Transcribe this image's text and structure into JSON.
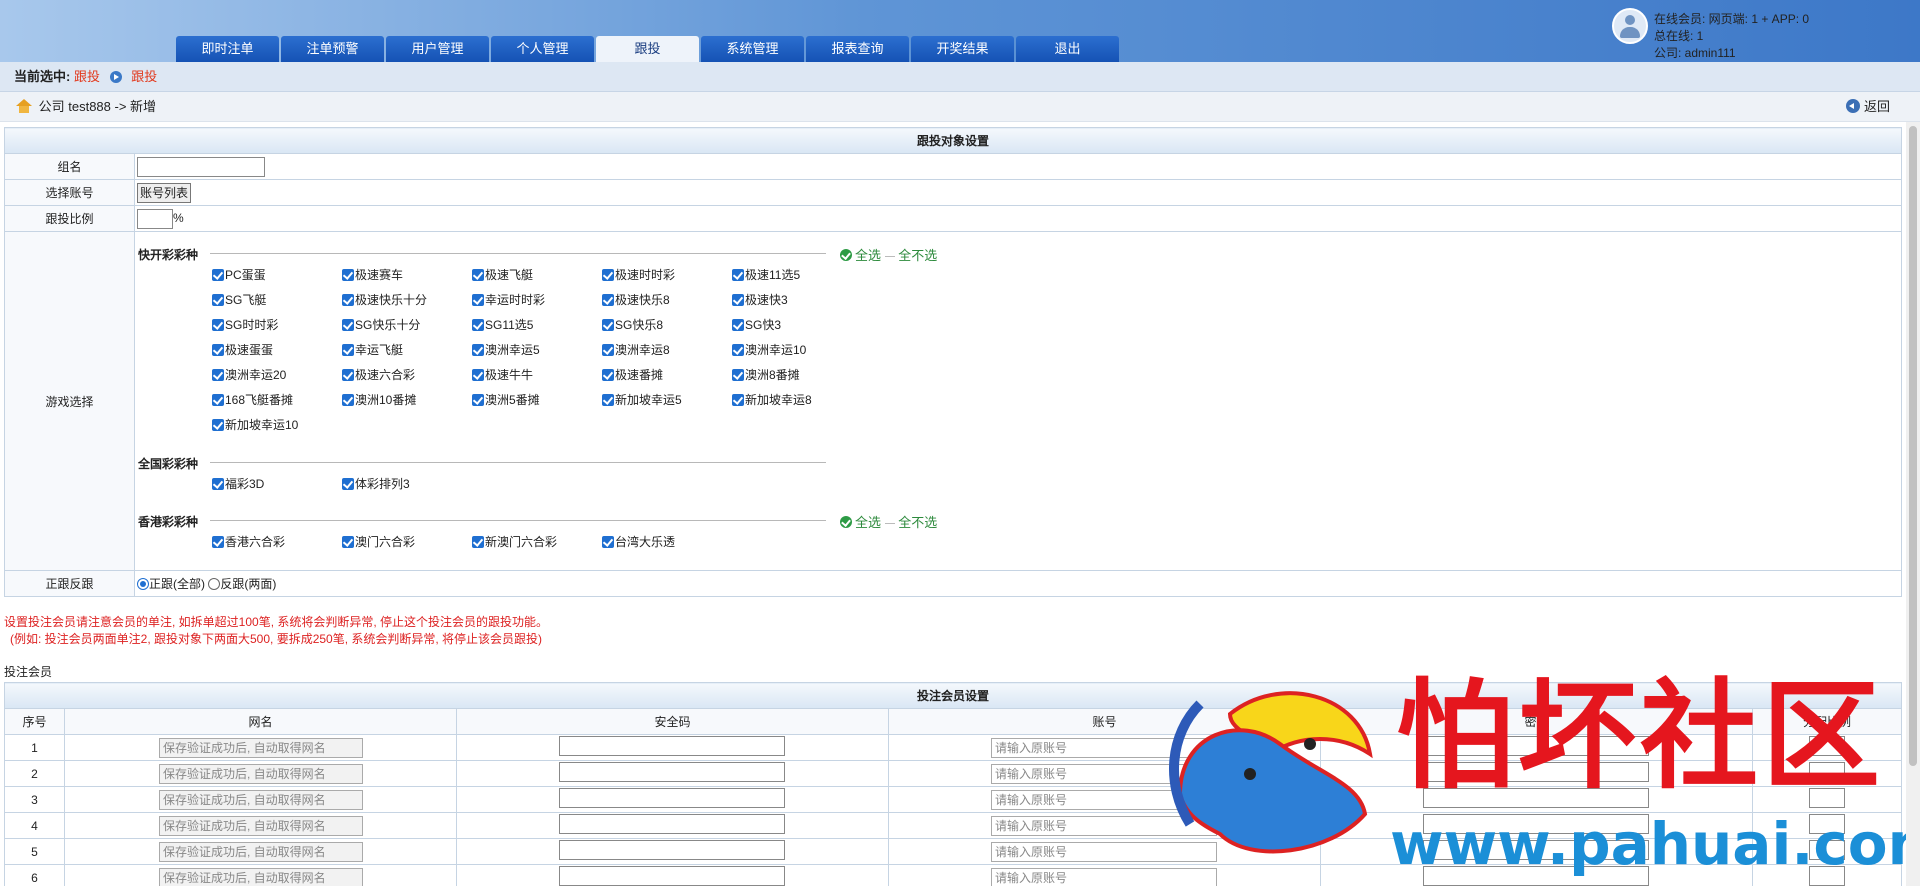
{
  "nav": {
    "tabs": [
      "即时注单",
      "注单预警",
      "用户管理",
      "个人管理",
      "跟投",
      "系统管理",
      "报表查询",
      "开奖结果",
      "退出"
    ],
    "active": "跟投"
  },
  "user": {
    "line1": "在线会员:   网页端: 1 + APP: 0",
    "line2": "总在线:  1",
    "line3": "公司: admin111"
  },
  "crumb": {
    "label": "当前选中:",
    "item1": "跟投",
    "item2": "跟投"
  },
  "path": {
    "text": "公司 test888 -> 新增",
    "back": "返回"
  },
  "settings": {
    "title": "跟投对象设置",
    "group_name_label": "组名",
    "account_label": "选择账号",
    "account_button": "账号列表",
    "ratio_label": "跟投比例",
    "ratio_unit": "%",
    "game_label": "游戏选择",
    "direction_label": "正跟反跟",
    "direction_options": [
      "正跟(全部)",
      "反跟(两面)"
    ],
    "select_all": "全选",
    "deselect_all": "全不选",
    "groups": {
      "fast": {
        "title": "快开彩彩种",
        "items": [
          "PC蛋蛋",
          "极速赛车",
          "极速飞艇",
          "极速时时彩",
          "极速11选5",
          "SG飞艇",
          "极速快乐十分",
          "幸运时时彩",
          "极速快乐8",
          "极速快3",
          "SG时时彩",
          "SG快乐十分",
          "SG11选5",
          "SG快乐8",
          "SG快3",
          "极速蛋蛋",
          "幸运飞艇",
          "澳洲幸运5",
          "澳洲幸运8",
          "澳洲幸运10",
          "澳洲幸运20",
          "极速六合彩",
          "极速牛牛",
          "极速番摊",
          "澳洲8番摊",
          "168飞艇番摊",
          "澳洲10番摊",
          "澳洲5番摊",
          "新加坡幸运5",
          "新加坡幸运8",
          "新加坡幸运10"
        ]
      },
      "national": {
        "title": "全国彩彩种",
        "items": [
          "福彩3D",
          "体彩排列3"
        ]
      },
      "hk": {
        "title": "香港彩彩种",
        "items": [
          "香港六合彩",
          "澳门六合彩",
          "新澳门六合彩",
          "台湾大乐透"
        ]
      }
    }
  },
  "notice": {
    "line1": "设置投注会员请注意会员的单注, 如拆单超过100笔, 系统将会判断异常, 停止这个投注会员的跟投功能。",
    "line2": "(例如: 投注会员两面单注2, 跟投对象下两面大500, 要拆成250笔, 系统会判断异常, 将停止该会员跟投)"
  },
  "members": {
    "section_label": "投注会员",
    "title": "投注会员设置",
    "columns": [
      "序号",
      "网名",
      "安全码",
      "账号",
      "密码",
      "分配比例"
    ],
    "netname_placeholder": "保存验证成功后, 自动取得网名",
    "account_placeholder": "请输入原账号",
    "rows": [
      "1",
      "2",
      "3",
      "4",
      "5",
      "6"
    ]
  },
  "watermark": {
    "title": "怕坏社区",
    "url": "www.pahuai.com"
  }
}
